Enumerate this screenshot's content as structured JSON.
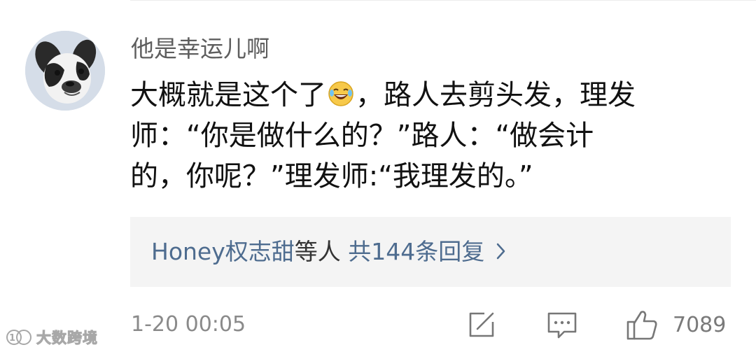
{
  "comment": {
    "username": "他是幸运儿啊",
    "lines": [
      "大概就是这个了",
      "，路人去剪头发，理发",
      "师：“你是做什么的？”路人：“做会计",
      "的，你呢？”理发师:“我理发的。”"
    ],
    "emoji": "laughing-crying-emoji"
  },
  "replies": {
    "names": "Honey权志甜",
    "middle": "等人",
    "count_text": "共144条回复"
  },
  "footer": {
    "timestamp": "1-20 00:05",
    "like_count": "7089"
  },
  "watermark": {
    "text": "大数跨境"
  },
  "colors": {
    "link": "#4e6c8f",
    "reply_bg": "#f4f4f4",
    "username": "#5e5e5e"
  }
}
